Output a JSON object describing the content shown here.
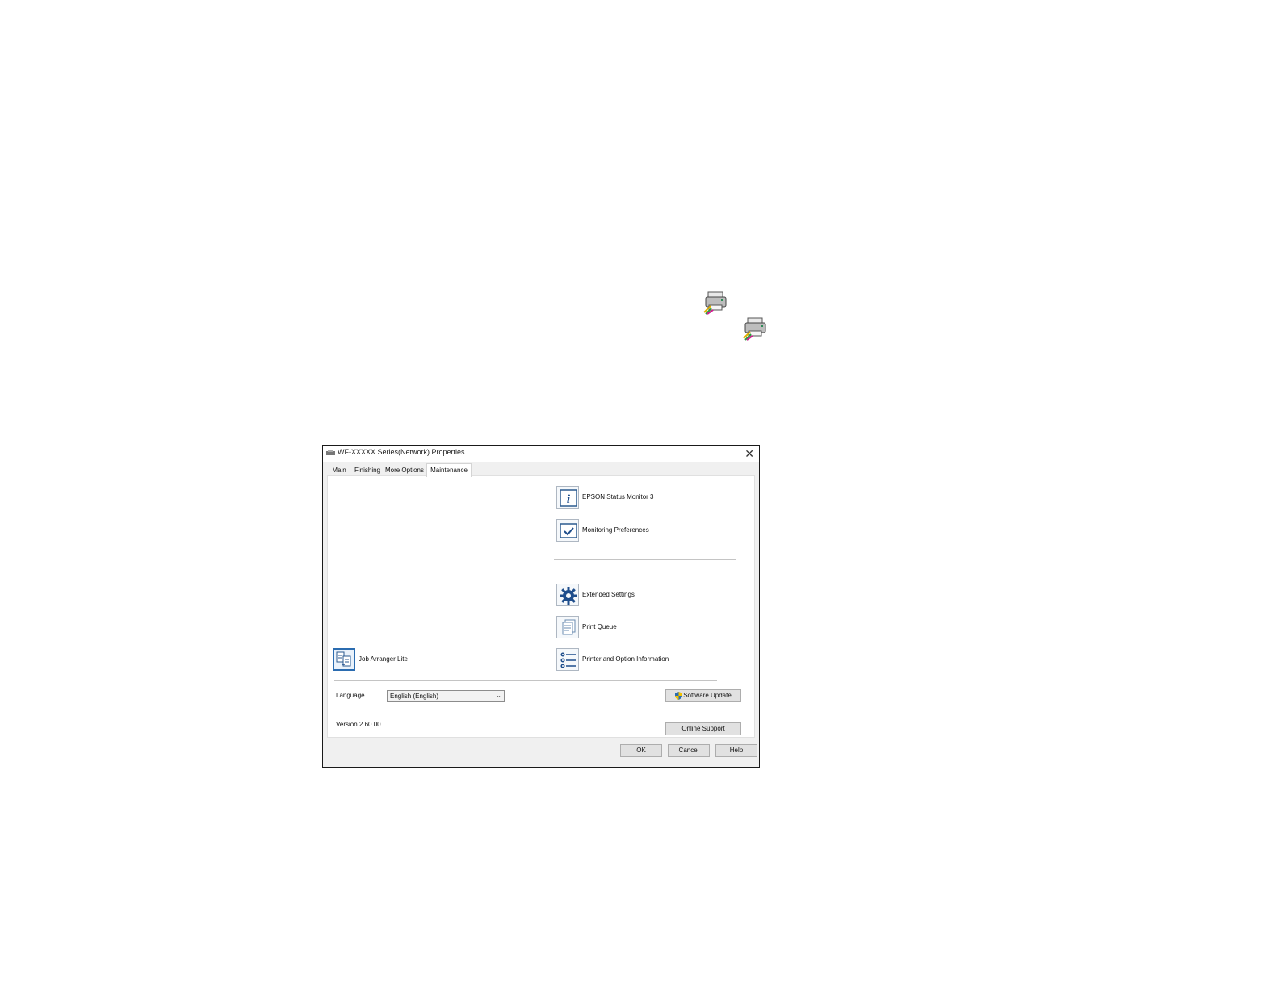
{
  "dialog": {
    "title": "WF-XXXXX Series(Network) Properties",
    "close_glyph": "✕",
    "tabs": [
      {
        "label": "Main"
      },
      {
        "label": "Finishing"
      },
      {
        "label": "More Options"
      },
      {
        "label": "Maintenance",
        "active": true
      }
    ],
    "tools": {
      "status_monitor": {
        "label": "EPSON Status Monitor 3",
        "icon": "info-icon"
      },
      "monitoring_prefs": {
        "label": "Monitoring Preferences",
        "icon": "checkbox-icon"
      },
      "extended_settings": {
        "label": "Extended Settings",
        "icon": "gear-icon"
      },
      "print_queue": {
        "label": "Print Queue",
        "icon": "print-queue-icon"
      },
      "printer_info": {
        "label": "Printer and Option Information",
        "icon": "list-icon"
      },
      "job_arranger": {
        "label": "Job Arranger Lite",
        "icon": "job-arranger-icon"
      }
    },
    "language": {
      "label": "Language",
      "value": "English (English)"
    },
    "version": "Version 2.60.00",
    "buttons": {
      "software_update": "Software Update",
      "online_support": "Online Support",
      "ok": "OK",
      "cancel": "Cancel",
      "help": "Help"
    }
  },
  "page_icons": [
    "printer-status-icon",
    "printer-status-icon"
  ]
}
